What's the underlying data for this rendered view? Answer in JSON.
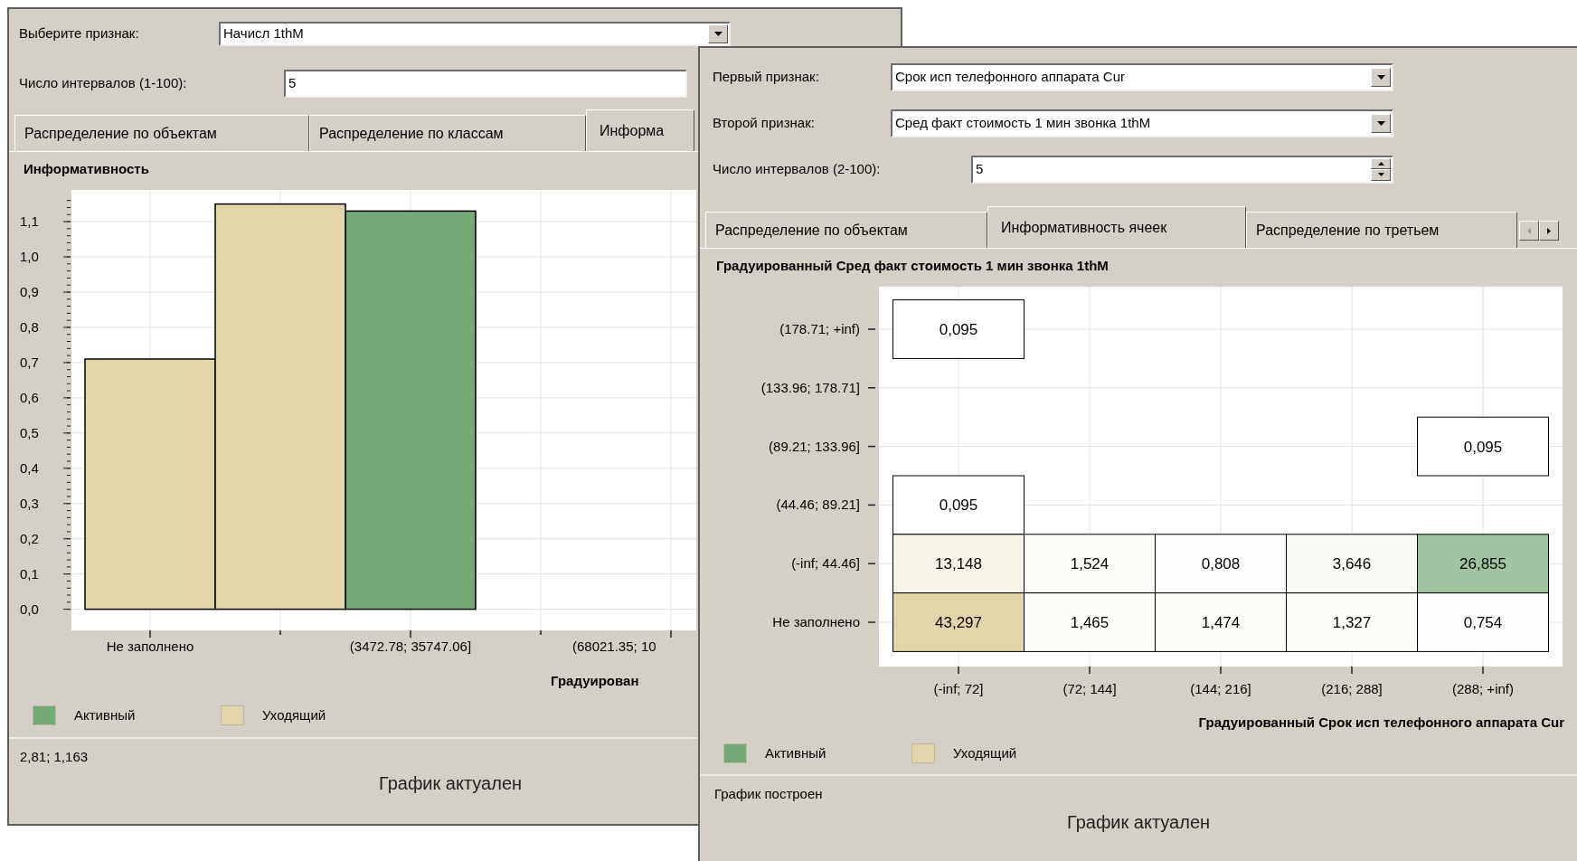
{
  "left_window": {
    "fields": [
      {
        "kind": "combo",
        "label": "Выберите признак:",
        "value": "Начисл 1thM"
      },
      {
        "kind": "text",
        "label": "Число интервалов (1-100):",
        "value": "5"
      }
    ],
    "tabs": [
      {
        "label": "Распределение по объектам",
        "selected": false
      },
      {
        "label": "Распределение по классам",
        "selected": false
      },
      {
        "label": "Информа",
        "selected": true
      }
    ],
    "chart_data": {
      "type": "bar",
      "title": "Информативность",
      "xlabel": "Градуирован",
      "grid": true,
      "categories": [
        "Не заполнено",
        null,
        "(3472.78; 35747.06]",
        null,
        "(68021.35; 10"
      ],
      "ylim": [
        -0.06,
        1.19
      ],
      "yticks": [
        {
          "value": 0,
          "label": "0,0"
        },
        {
          "value": 0.1,
          "label": "0,1"
        },
        {
          "value": 0.2,
          "label": "0,2"
        },
        {
          "value": 0.3,
          "label": "0,3"
        },
        {
          "value": 0.4,
          "label": "0,4"
        },
        {
          "value": 0.5,
          "label": "0,5"
        },
        {
          "value": 0.6,
          "label": "0,6"
        },
        {
          "value": 0.7,
          "label": "0,7"
        },
        {
          "value": 0.8,
          "label": "0,8"
        },
        {
          "value": 0.9,
          "label": "0,9"
        },
        {
          "value": 1.0,
          "label": "1,0"
        },
        {
          "value": 1.1,
          "label": "1,1"
        }
      ],
      "series": [
        {
          "name": "Активный",
          "color": "#76a978",
          "values": [
            null,
            null,
            1.13,
            null,
            null
          ]
        },
        {
          "name": "Уходящий",
          "color": "#e3d5aa",
          "values": [
            0.71,
            1.15,
            null,
            null,
            null
          ]
        }
      ]
    },
    "status": "2,81; 1,163",
    "footer": "График актуален"
  },
  "right_window": {
    "fields": [
      {
        "kind": "combo",
        "label": "Первый признак:",
        "value": "Срок исп телефонного аппарата Cur"
      },
      {
        "kind": "combo",
        "label": "Второй признак:",
        "value": "Сред факт стоимость 1 мин звонка 1thM"
      },
      {
        "kind": "spin",
        "label": "Число интервалов (2-100):",
        "value": "5"
      }
    ],
    "tabs": [
      {
        "label": "Распределение по объектам",
        "selected": false
      },
      {
        "label": "Информативность ячеек",
        "selected": true
      },
      {
        "label": "Распределение по третьем",
        "selected": false
      }
    ],
    "cell_chart": {
      "title": "Градуированный Сред факт стоимость 1 мин звонка 1thM",
      "row_labels": [
        "(178.71; +inf)",
        "(133.96; 178.71]",
        "(89.21; 133.96]",
        "(44.46; 89.21]",
        "(-inf; 44.46]",
        "Не заполнено"
      ],
      "column_labels": [
        "(-inf; 72]",
        "(72; 144]",
        "(144; 216]",
        "(216; 288]",
        "(288; +inf)"
      ],
      "xlabel": "Градуированный Срок исп телефонного аппарата Cur",
      "rows": [
        {
          "cells": [
            {
              "kind": "value",
              "value": "0,095",
              "color": "#ffffff"
            },
            {
              "kind": "empty"
            },
            {
              "kind": "empty"
            },
            {
              "kind": "empty"
            },
            {
              "kind": "empty"
            }
          ]
        },
        {
          "cells": [
            {
              "kind": "empty"
            },
            {
              "kind": "empty"
            },
            {
              "kind": "empty"
            },
            {
              "kind": "empty"
            },
            {
              "kind": "empty"
            }
          ]
        },
        {
          "cells": [
            {
              "kind": "empty"
            },
            {
              "kind": "empty"
            },
            {
              "kind": "empty"
            },
            {
              "kind": "empty"
            },
            {
              "kind": "value",
              "value": "0,095",
              "color": "#ffffff"
            }
          ]
        },
        {
          "cells": [
            {
              "kind": "value",
              "value": "0,095",
              "color": "#ffffff"
            },
            {
              "kind": "empty"
            },
            {
              "kind": "empty"
            },
            {
              "kind": "empty"
            },
            {
              "kind": "empty"
            }
          ]
        },
        {
          "cells": [
            {
              "kind": "value",
              "value": "13,148",
              "color": "#f7f4ea"
            },
            {
              "kind": "value",
              "value": "1,524",
              "color": "#fdfcf9"
            },
            {
              "kind": "value",
              "value": "0,808",
              "color": "#fefefd"
            },
            {
              "kind": "value",
              "value": "3,646",
              "color": "#fbf9f4"
            },
            {
              "kind": "value",
              "value": "26,855",
              "color": "#9fc6a0"
            }
          ]
        },
        {
          "cells": [
            {
              "kind": "value",
              "value": "43,297",
              "color": "#e3d5aa"
            },
            {
              "kind": "value",
              "value": "1,465",
              "color": "#fdfcf9"
            },
            {
              "kind": "value",
              "value": "1,474",
              "color": "#fdfcf9"
            },
            {
              "kind": "value",
              "value": "1,327",
              "color": "#fdfcf9"
            },
            {
              "kind": "value",
              "value": "0,754",
              "color": "#fefefd"
            }
          ]
        }
      ]
    },
    "legend": [
      {
        "label": "Активный",
        "color": "#76a978"
      },
      {
        "label": "Уходящий",
        "color": "#e3d5aa"
      }
    ],
    "status": "График построен",
    "footer": "График актуален"
  }
}
